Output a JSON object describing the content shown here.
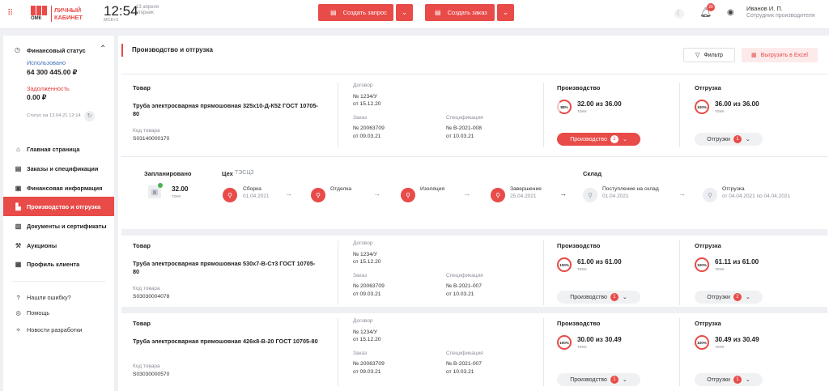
{
  "header": {
    "logo_name": "ОМК",
    "cabinet_line1": "ЛИЧНЫЙ",
    "cabinet_line2": "КАБИНЕТ",
    "time": "12:54",
    "date": "13 апреля",
    "weekday": "вторник",
    "timezone": "МСК+3",
    "create_request": "Создать запрос",
    "create_order": "Создать заказ",
    "notif_count": "20",
    "user_name": "Иванов И. П.",
    "user_role": "Сотрудник производителя"
  },
  "sidebar": {
    "fin_title": "Финансовый статус",
    "used_label": "Использовано",
    "used_value": "64 300 445.00 ₽",
    "debt_label": "Задолженность",
    "debt_value": "0.00 ₽",
    "status_text": "Статус на 13.04.21 12:14",
    "nav": [
      {
        "label": "Главная страница",
        "icon": "home-icon"
      },
      {
        "label": "Заказы и спецификации",
        "icon": "document-icon"
      },
      {
        "label": "Финансовая информация",
        "icon": "wallet-icon"
      },
      {
        "label": "Производство и отгрузка",
        "icon": "factory-icon"
      },
      {
        "label": "Документы и сертификаты",
        "icon": "files-icon"
      },
      {
        "label": "Аукционы",
        "icon": "auction-icon"
      },
      {
        "label": "Профиль клиента",
        "icon": "profile-icon"
      }
    ],
    "bottom": [
      {
        "label": "Нашли ошибку?",
        "icon": "bug-icon"
      },
      {
        "label": "Помощь",
        "icon": "help-icon"
      },
      {
        "label": "Новости разработки",
        "icon": "news-icon"
      }
    ]
  },
  "main": {
    "title": "Производство и отгрузка",
    "filter": "Фильтр",
    "export": "Выгрузить в Excel",
    "labels": {
      "product": "Товар",
      "contract": "Договор",
      "order": "Заказ",
      "spec": "Спецификация",
      "code": "Код товара",
      "production": "Производство",
      "shipment": "Отгрузка",
      "unit": "тонн",
      "shipments_btn": "Отгрузки",
      "production_btn": "Производство"
    },
    "cards": [
      {
        "name": "Труба электросварная прямошовная 325х10-Д-К52 ГОСТ 10705-80",
        "code": "S03140000170",
        "contract": "№ 1234/У",
        "contract_date": "от 15.12.20",
        "order": "№ 20063709",
        "order_date": "от 09.03.21",
        "spec": "№ В-2021-008",
        "spec_date": "от 10.03.21",
        "prod_pct": "88%",
        "prod_amount": "32.00 из 36.00",
        "prod_badge": "1",
        "ship_pct": "100%",
        "ship_amount": "36.00 из 36.00",
        "ship_badge": "1"
      },
      {
        "name": "Труба электросварная прямошовная 530х7-В-Ст3 ГОСТ 10705-80",
        "code": "S03030004078",
        "contract": "№ 1234/У",
        "contract_date": "от 15.12.20",
        "order": "№ 20063709",
        "order_date": "от 09.03.21",
        "spec": "№ В-2021-007",
        "spec_date": "от 10.03.21",
        "prod_pct": "100%",
        "prod_amount": "61.00 из 61.00",
        "prod_badge": "1",
        "ship_pct": "100%",
        "ship_amount": "61.11 из 61.00",
        "ship_badge": "2"
      },
      {
        "name": "Труба электросварная прямошовная 426х8-В-20 ГОСТ 10705-80",
        "code": "S03030000570",
        "contract": "№ 1234/У",
        "contract_date": "от 15.12.20",
        "order": "№ 20063709",
        "order_date": "от 09.03.21",
        "spec": "№ В-2021-007",
        "spec_date": "от 10.03.21",
        "prod_pct": "100%",
        "prod_amount": "30.00 из 30.49",
        "prod_badge": "1",
        "ship_pct": "100%",
        "ship_amount": "30.49 из 30.49",
        "ship_badge": "1"
      }
    ],
    "timeline": {
      "planned_label": "Запланировано",
      "planned_value": "32.00",
      "planned_unit": "тонн",
      "workshop_label": "Цех",
      "workshop_value": "ТЭСЦ3",
      "warehouse_label": "Склад",
      "steps": [
        {
          "name": "Сборка",
          "date": "01.04.2021"
        },
        {
          "name": "Отделка",
          "date": ""
        },
        {
          "name": "Изоляция",
          "date": ""
        },
        {
          "name": "Завершение",
          "date": "25.04.2021"
        },
        {
          "name": "Поступление на склад",
          "date": "01.04.2021"
        },
        {
          "name": "Отгрузка",
          "date": "от 04.04.2021 по 04.04.2021"
        }
      ]
    }
  }
}
